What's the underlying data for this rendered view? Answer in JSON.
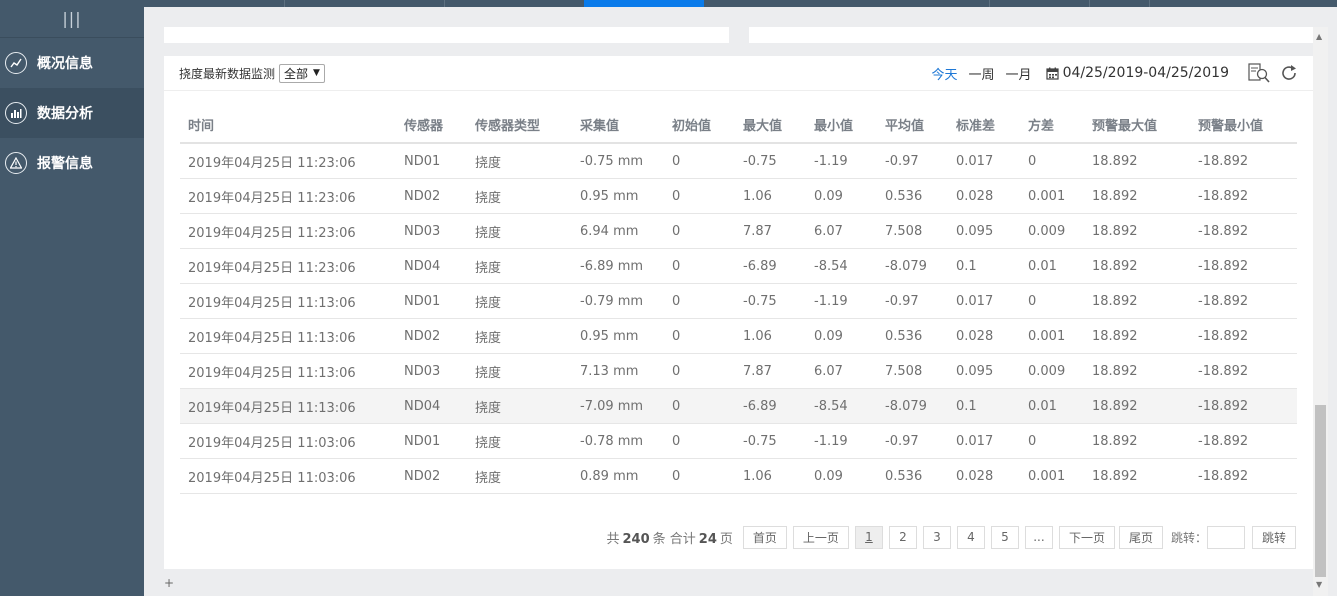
{
  "sidebar": {
    "toggle_icon": "menu-bars",
    "items": [
      {
        "label": "概况信息",
        "icon": "trend-line-icon",
        "active": false
      },
      {
        "label": "数据分析",
        "icon": "bar-chart-icon",
        "active": true
      },
      {
        "label": "报警信息",
        "icon": "warning-icon",
        "active": false
      }
    ]
  },
  "colors": {
    "sidebar_bg": "#44596b",
    "accent": "#0a7bea",
    "active_link": "#1e78d6"
  },
  "panel": {
    "title": "挠度最新数据监测",
    "filter_value": "全部",
    "ranges": [
      "今天",
      "一周",
      "一月"
    ],
    "active_range": "今天",
    "date_range": "04/25/2019-04/25/2019"
  },
  "table": {
    "columns": [
      "时间",
      "传感器",
      "传感器类型",
      "采集值",
      "初始值",
      "最大值",
      "最小值",
      "平均值",
      "标准差",
      "方差",
      "预警最大值",
      "预警最小值"
    ],
    "rows": [
      [
        "2019年04月25日 11:23:06",
        "ND01",
        "挠度",
        "-0.75 mm",
        "0",
        "-0.75",
        "-1.19",
        "-0.97",
        "0.017",
        "0",
        "18.892",
        "-18.892"
      ],
      [
        "2019年04月25日 11:23:06",
        "ND02",
        "挠度",
        "0.95 mm",
        "0",
        "1.06",
        "0.09",
        "0.536",
        "0.028",
        "0.001",
        "18.892",
        "-18.892"
      ],
      [
        "2019年04月25日 11:23:06",
        "ND03",
        "挠度",
        "6.94 mm",
        "0",
        "7.87",
        "6.07",
        "7.508",
        "0.095",
        "0.009",
        "18.892",
        "-18.892"
      ],
      [
        "2019年04月25日 11:23:06",
        "ND04",
        "挠度",
        "-6.89 mm",
        "0",
        "-6.89",
        "-8.54",
        "-8.079",
        "0.1",
        "0.01",
        "18.892",
        "-18.892"
      ],
      [
        "2019年04月25日 11:13:06",
        "ND01",
        "挠度",
        "-0.79 mm",
        "0",
        "-0.75",
        "-1.19",
        "-0.97",
        "0.017",
        "0",
        "18.892",
        "-18.892"
      ],
      [
        "2019年04月25日 11:13:06",
        "ND02",
        "挠度",
        "0.95 mm",
        "0",
        "1.06",
        "0.09",
        "0.536",
        "0.028",
        "0.001",
        "18.892",
        "-18.892"
      ],
      [
        "2019年04月25日 11:13:06",
        "ND03",
        "挠度",
        "7.13 mm",
        "0",
        "7.87",
        "6.07",
        "7.508",
        "0.095",
        "0.009",
        "18.892",
        "-18.892"
      ],
      [
        "2019年04月25日 11:13:06",
        "ND04",
        "挠度",
        "-7.09 mm",
        "0",
        "-6.89",
        "-8.54",
        "-8.079",
        "0.1",
        "0.01",
        "18.892",
        "-18.892"
      ],
      [
        "2019年04月25日 11:03:06",
        "ND01",
        "挠度",
        "-0.78 mm",
        "0",
        "-0.75",
        "-1.19",
        "-0.97",
        "0.017",
        "0",
        "18.892",
        "-18.892"
      ],
      [
        "2019年04月25日 11:03:06",
        "ND02",
        "挠度",
        "0.89 mm",
        "0",
        "1.06",
        "0.09",
        "0.536",
        "0.028",
        "0.001",
        "18.892",
        "-18.892"
      ]
    ],
    "highlighted_row": 7
  },
  "pager": {
    "prefix": "共",
    "total": "240",
    "total_unit": "条 合计",
    "pages": "24",
    "pages_unit": "页",
    "first": "首页",
    "prev": "上一页",
    "page_numbers": [
      "1",
      "2",
      "3",
      "4",
      "5",
      "..."
    ],
    "current_page": "1",
    "next": "下一页",
    "last": "尾页",
    "jump_label": "跳转：",
    "jump_button": "跳转"
  },
  "footer_mark": "+"
}
